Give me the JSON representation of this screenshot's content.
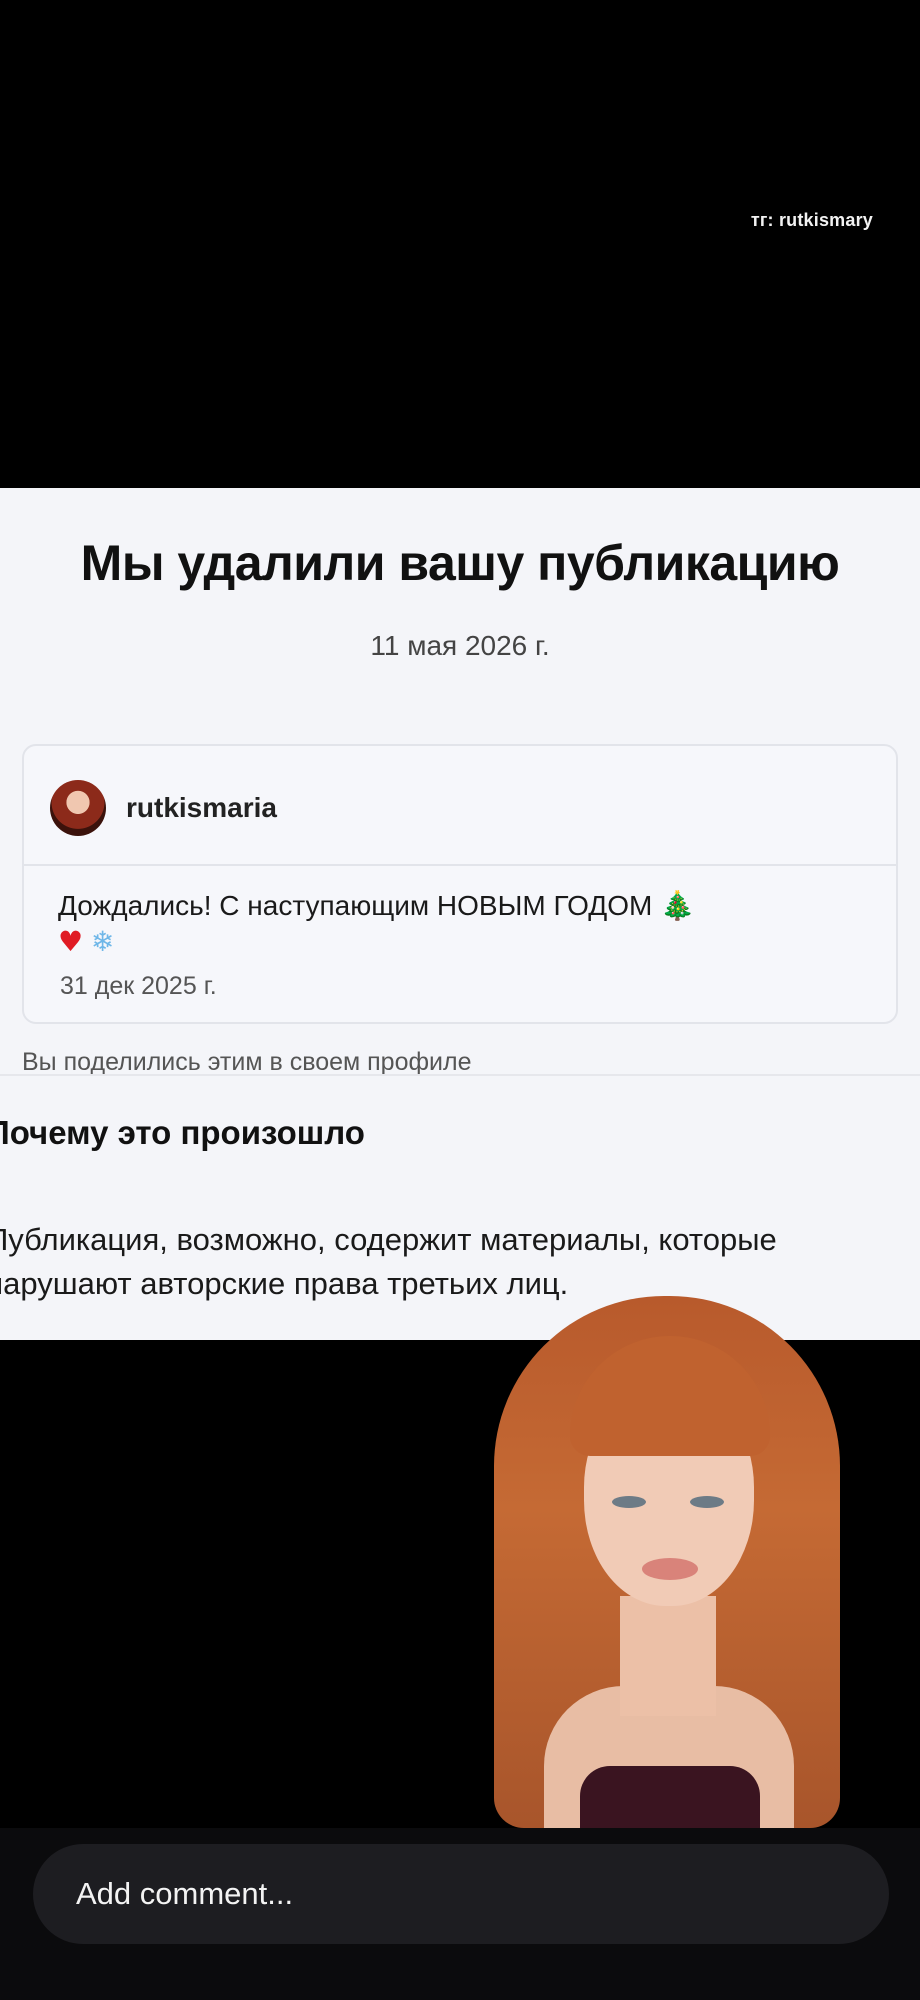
{
  "watermark": "тг: rutkismary",
  "notice": {
    "title": "Мы удалили вашу публикацию",
    "date": "11 мая 2026 г.",
    "post": {
      "username": "rutkismaria",
      "text": "Дождались! С наступающим НОВЫМ ГОДОМ",
      "emoji_1": "🎄",
      "emoji_2": "♥",
      "emoji_3": "❄",
      "date": "31 дек 2025 г."
    },
    "shared_note": "Вы поделились этим в своем профиле",
    "why_title": "Почему это произошло",
    "why_body": "Публикация, возможно, содержит материалы, которые нарушают авторские права третьих лиц."
  },
  "comment": {
    "placeholder": "Add comment..."
  }
}
